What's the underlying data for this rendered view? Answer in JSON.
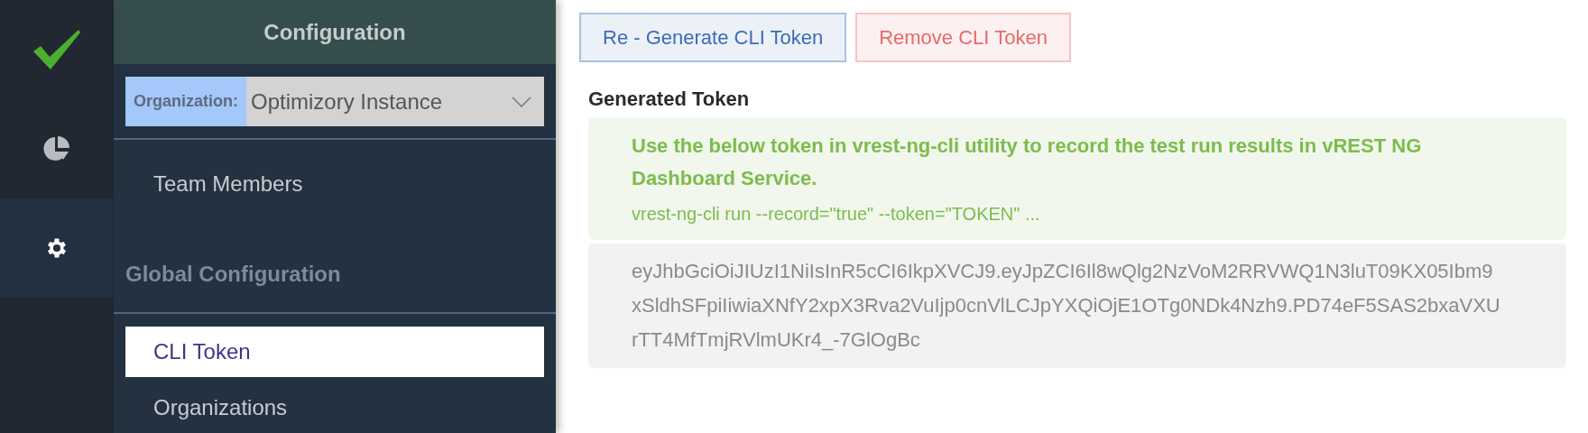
{
  "rail": {
    "items": [
      {
        "kind": "check",
        "selected": false
      },
      {
        "kind": "pie",
        "selected": false
      },
      {
        "kind": "gear",
        "selected": true
      }
    ]
  },
  "sidebar": {
    "title": "Configuration",
    "organization": {
      "label": "Organization:",
      "value": "Optimizory Instance"
    },
    "sections": [
      {
        "items": [
          {
            "label": "Team Members",
            "selected": false
          }
        ]
      },
      {
        "heading": "Global Configuration",
        "items": [
          {
            "label": "CLI Token",
            "selected": true
          },
          {
            "label": "Organizations",
            "selected": false
          }
        ]
      }
    ]
  },
  "buttons": [
    {
      "label": "Re - Generate CLI Token",
      "kind": "primary"
    },
    {
      "label": "Remove CLI Token",
      "kind": "danger"
    }
  ],
  "token_section": {
    "heading": "Generated Token",
    "notice": "Use the below token in vrest-ng-cli utility to record the test run results in vREST NG Dashboard Service.",
    "command": "vrest-ng-cli run --record=\"true\" --token=\"TOKEN\" ...",
    "token": "eyJhbGciOiJIUzI1NiIsInR5cCI6IkpXVCJ9.eyJpZCI6Il8wQlg2NzVoM2RRVWQ1N3luT09KX05Ibm9xSldhSFpiIiwiaXNfY2xpX3Rva2VuIjp0cnVlLCJpYXQiOjE1OTg0NDk4Nzh9.PD74eF5SAS2bxaVXUrTT4MfTmjRVlmUKr4_-7GlOgBc"
  }
}
